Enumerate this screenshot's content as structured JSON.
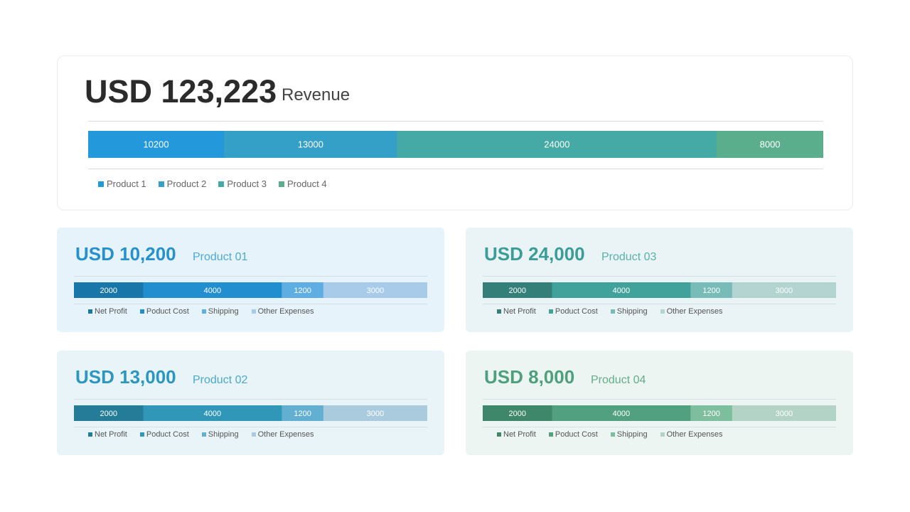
{
  "main": {
    "amount": "USD 123,223",
    "subtitle": "Revenue",
    "legend": [
      "Product 1",
      "Product 2",
      "Product 3",
      "Product 4"
    ]
  },
  "cards": [
    {
      "amount": "USD 10,200",
      "product": "Product 01",
      "legend": [
        "Net Profit",
        "Poduct Cost",
        "Shipping",
        "Other Expenses"
      ],
      "amount_color": "#2591cf",
      "sub_color": "#4ea9d9",
      "bg": "#e6f3fa"
    },
    {
      "amount": "USD 24,000",
      "product": "Product 03",
      "legend": [
        "Net Profit",
        "Poduct Cost",
        "Shipping",
        "Other Expenses"
      ],
      "amount_color": "#3b9d98",
      "sub_color": "#59b1ab",
      "bg": "#eaf3f5"
    },
    {
      "amount": "USD 13,000",
      "product": "Product 02",
      "legend": [
        "Net Profit",
        "Poduct Cost",
        "Shipping",
        "Other Expenses"
      ],
      "amount_color": "#2c97be",
      "sub_color": "#4aa9cb",
      "bg": "#e8f4f8"
    },
    {
      "amount": "USD 8,000",
      "product": "Product 04",
      "legend": [
        "Net Profit",
        "Poduct Cost",
        "Shipping",
        "Other Expenses"
      ],
      "amount_color": "#4ea07c",
      "sub_color": "#63ad8b",
      "bg": "#ecf5f2"
    }
  ],
  "chart_data": [
    {
      "type": "bar",
      "stacked": true,
      "orientation": "horizontal",
      "categories": [
        "Revenue"
      ],
      "series": [
        {
          "name": "Product 1",
          "values": [
            10200
          ],
          "color": "#2399db"
        },
        {
          "name": "Product 2",
          "values": [
            13000
          ],
          "color": "#35a0c7"
        },
        {
          "name": "Product 3",
          "values": [
            24000
          ],
          "color": "#45aaa6"
        },
        {
          "name": "Product 4",
          "values": [
            8000
          ],
          "color": "#5aae8b"
        }
      ]
    },
    {
      "type": "bar",
      "stacked": true,
      "orientation": "horizontal",
      "categories": [
        "Product 01"
      ],
      "series": [
        {
          "name": "Net Profit",
          "values": [
            2000
          ],
          "color": "#1877a8"
        },
        {
          "name": "Poduct Cost",
          "values": [
            4000
          ],
          "color": "#218ecf"
        },
        {
          "name": "Shipping",
          "values": [
            1200
          ],
          "color": "#5eaee2"
        },
        {
          "name": "Other Expenses",
          "values": [
            3000
          ],
          "color": "#a8cbea"
        }
      ]
    },
    {
      "type": "bar",
      "stacked": true,
      "orientation": "horizontal",
      "categories": [
        "Product 03"
      ],
      "series": [
        {
          "name": "Net Profit",
          "values": [
            2000
          ],
          "color": "#348078"
        },
        {
          "name": "Poduct Cost",
          "values": [
            4000
          ],
          "color": "#40a29b"
        },
        {
          "name": "Shipping",
          "values": [
            1200
          ],
          "color": "#77bcb6"
        },
        {
          "name": "Other Expenses",
          "values": [
            3000
          ],
          "color": "#b4d4d1"
        }
      ]
    },
    {
      "type": "bar",
      "stacked": true,
      "orientation": "horizontal",
      "categories": [
        "Product 02"
      ],
      "series": [
        {
          "name": "Net Profit",
          "values": [
            2000
          ],
          "color": "#247c98"
        },
        {
          "name": "Poduct Cost",
          "values": [
            4000
          ],
          "color": "#3097b9"
        },
        {
          "name": "Shipping",
          "values": [
            1200
          ],
          "color": "#62afd1"
        },
        {
          "name": "Other Expenses",
          "values": [
            3000
          ],
          "color": "#aacbdd"
        }
      ]
    },
    {
      "type": "bar",
      "stacked": true,
      "orientation": "horizontal",
      "categories": [
        "Product 04"
      ],
      "series": [
        {
          "name": "Net Profit",
          "values": [
            2000
          ],
          "color": "#3e876a"
        },
        {
          "name": "Poduct Cost",
          "values": [
            4000
          ],
          "color": "#51a07f"
        },
        {
          "name": "Shipping",
          "values": [
            1200
          ],
          "color": "#7dbe9f"
        },
        {
          "name": "Other Expenses",
          "values": [
            3000
          ],
          "color": "#b2d3c6"
        }
      ]
    }
  ]
}
